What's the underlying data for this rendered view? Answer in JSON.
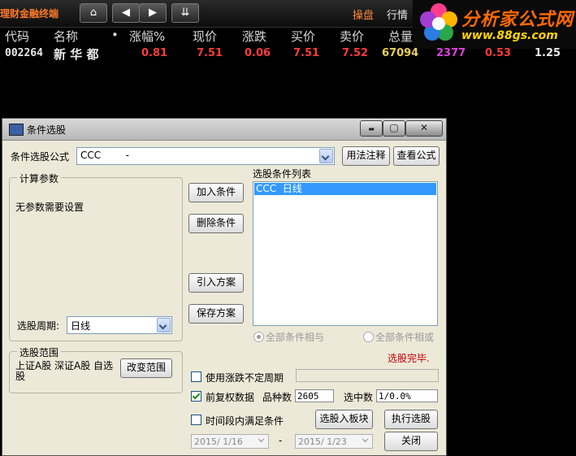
{
  "app": {
    "title": "理财金融终端",
    "trade_tab": "操盘",
    "quote_tab": "行情",
    "nav_home": "⌂",
    "nav_prev": "◀",
    "nav_next": "▶",
    "nav_down": "⇊",
    "logo_name": "分析家公式网",
    "logo_url": "www.88gs.com",
    "colors": {
      "accent": "#ff7a2a",
      "logo_orange": "#ff6a00",
      "logo_yellow": "#ffd400"
    }
  },
  "quote": {
    "headers": {
      "code": "代码",
      "name": "名称",
      "dot": "•",
      "change_pct": "涨幅%",
      "price": "现价",
      "change": "涨跌",
      "bid": "买价",
      "ask": "卖价",
      "volume": "总量"
    },
    "row": {
      "code": "002264",
      "name": "新 华 都",
      "change_pct": "0.81",
      "price": "7.51",
      "change": "0.06",
      "bid": "7.51",
      "ask": "7.52",
      "volume": "67094",
      "extra1": "2377",
      "extra2": "0.53",
      "extra3": "1.25"
    },
    "colors": {
      "code": "#e8e8e8",
      "name": "#e8e8e8",
      "up": "#ff3c3c",
      "volume": "#e8d060",
      "extra1": "#e040e0",
      "extra3": "#e8e8e8"
    }
  },
  "dialog": {
    "title": "条件选股",
    "min": "▬",
    "max": "▢",
    "close": "✕",
    "formula_label": "条件选股公式",
    "formula_value": "CCC        -",
    "usage_button": "用法注释",
    "view_formula_button": "查看公式",
    "params_group": "计算参数",
    "no_params_text": "无参数需要设置",
    "period_label": "选股周期:",
    "period_value": "日线",
    "list_label": "选股条件列表",
    "list_item": "CCC  日线",
    "add_button": "加入条件",
    "delete_button": "删除条件",
    "import_button": "引入方案",
    "save_button": "保存方案",
    "radio_and": "全部条件相与",
    "radio_or": "全部条件相或",
    "status": "选股完毕.",
    "scope_group": "选股范围",
    "scope_text": "上证A股 深证A股 自选股",
    "change_scope_button": "改变范围",
    "check_uncertain_period": "使用涨跌不定周期",
    "check_prev_adjust": "前复权数据",
    "variety_count_label": "品种数",
    "variety_count": "2605",
    "selected_count_label": "选中数",
    "selected_count": "1/0.0%",
    "check_period_satisfy": "时间段内满足条件",
    "to_block_button": "选股入板块",
    "run_button": "执行选股",
    "close_button": "关闭",
    "date_from": "2015/ 1/16",
    "date_sep": "-",
    "date_to": "2015/ 1/23",
    "colors": {
      "status": "#c00000",
      "selection": "#3399ff"
    }
  }
}
